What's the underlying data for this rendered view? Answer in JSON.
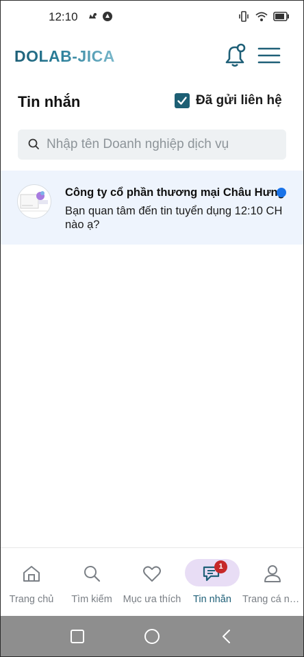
{
  "status_bar": {
    "time": "12:10",
    "left_icons": [
      "notification-icon",
      "circle-app-icon"
    ],
    "right_icons": [
      "vibrate-icon",
      "wifi-icon",
      "battery-icon"
    ]
  },
  "app_bar": {
    "logo": "DOLAB-JICA",
    "icons": [
      "bell-icon",
      "menu-icon"
    ]
  },
  "page": {
    "title": "Tin nhắn",
    "sent_filter": {
      "label": "Đã gửi liên hệ",
      "checked": true
    }
  },
  "search": {
    "placeholder": "Nhập tên Doanh nghiệp dịch vụ",
    "value": ""
  },
  "conversations": [
    {
      "name": "Công ty cổ phần thương mại Châu Hưng",
      "preview": "Bạn quan tâm đến tin tuyển dụng 12:10 CH nào ạ?",
      "unread": true
    }
  ],
  "bottom_nav": {
    "active": "Tin nhắn",
    "items": [
      {
        "label": "Trang chủ",
        "icon": "home-icon"
      },
      {
        "label": "Tìm kiếm",
        "icon": "search-icon"
      },
      {
        "label": "Mục ưa thích",
        "icon": "heart-icon"
      },
      {
        "label": "Tin nhắn",
        "icon": "chat-icon",
        "badge": "1"
      },
      {
        "label": "Trang cá nhân",
        "icon": "user-icon"
      }
    ]
  },
  "colors": {
    "accent": "#1e5f77",
    "unread_dot": "#1a73e8",
    "highlight_row": "#eef4fd",
    "badge": "#c62828",
    "active_pill": "#e8ddf5"
  }
}
